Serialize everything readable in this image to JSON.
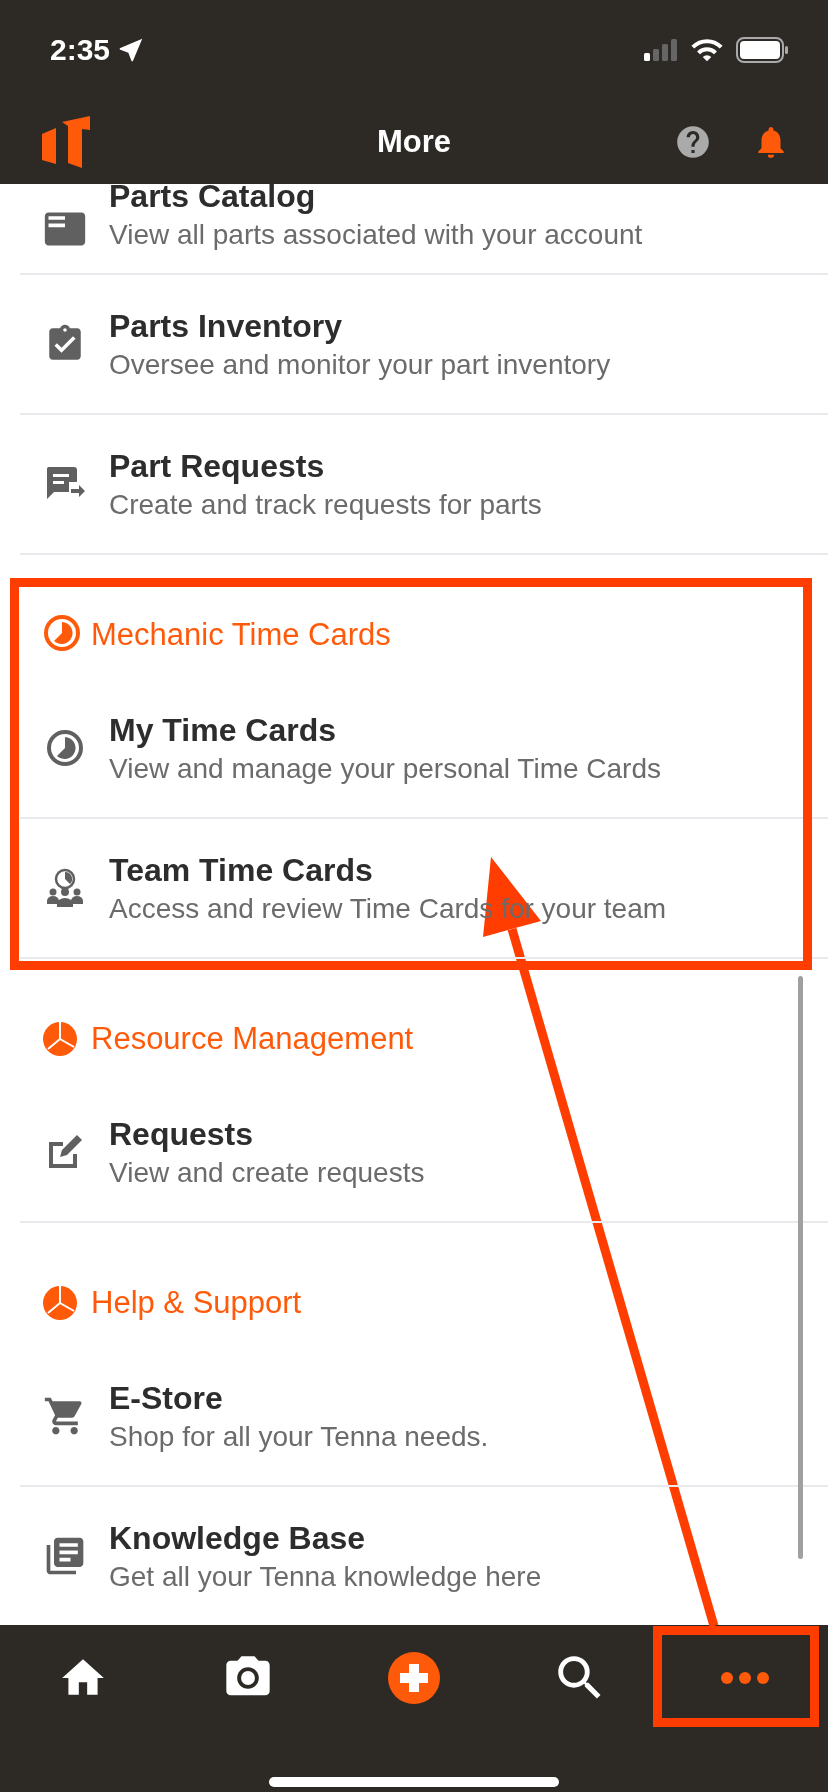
{
  "status_bar": {
    "time": "2:35"
  },
  "nav": {
    "title": "More"
  },
  "groups": [
    {
      "items": [
        {
          "title": "Parts Catalog",
          "subtitle": "View all parts associated with your account"
        },
        {
          "title": "Parts Inventory",
          "subtitle": "Oversee and monitor your part inventory"
        },
        {
          "title": "Part Requests",
          "subtitle": "Create and track requests for parts"
        }
      ]
    },
    {
      "heading": "Mechanic Time Cards",
      "items": [
        {
          "title": "My Time Cards",
          "subtitle": "View and manage your personal Time Cards"
        },
        {
          "title": "Team Time Cards",
          "subtitle": "Access and review Time Cards for your team"
        }
      ]
    },
    {
      "heading": "Resource Management",
      "items": [
        {
          "title": "Requests",
          "subtitle": "View and create requests"
        }
      ]
    },
    {
      "heading": "Help & Support",
      "items": [
        {
          "title": "E-Store",
          "subtitle": "Shop for all your Tenna needs."
        },
        {
          "title": "Knowledge Base",
          "subtitle": "Get all your Tenna knowledge here"
        }
      ]
    }
  ],
  "tab_bar": {
    "tabs": [
      {
        "selected": false
      },
      {
        "selected": false
      },
      {
        "selected": false
      },
      {
        "selected": false
      },
      {
        "selected": true
      }
    ]
  }
}
